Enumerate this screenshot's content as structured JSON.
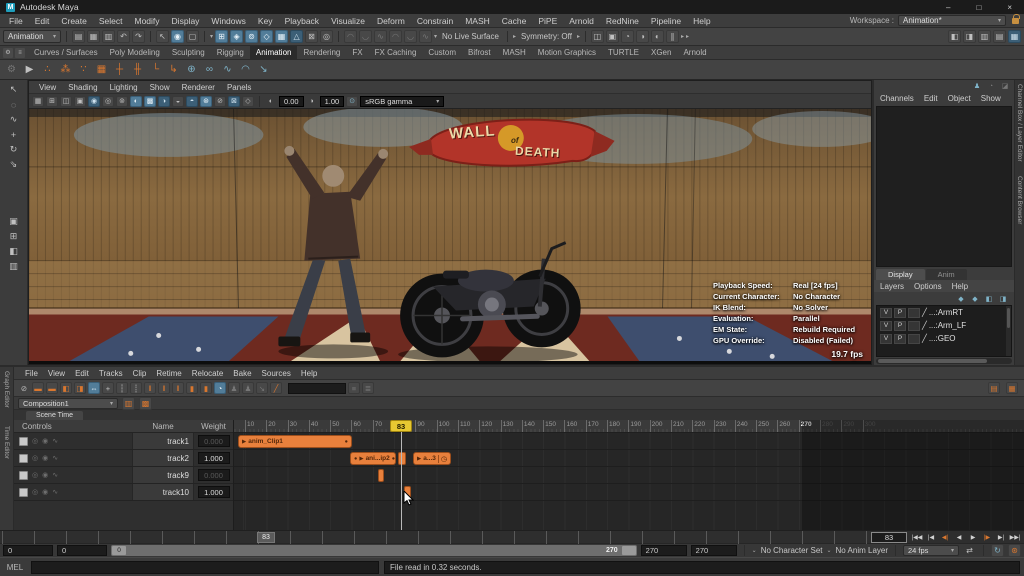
{
  "titlebar": {
    "app_title": "Autodesk Maya",
    "logo": "M"
  },
  "window_controls": {
    "minimize": "–",
    "maximize": "□",
    "close": "×"
  },
  "menubar": {
    "items": [
      "File",
      "Edit",
      "Create",
      "Select",
      "Modify",
      "Display",
      "Windows",
      "Key",
      "Playback",
      "Visualize",
      "Deform",
      "Constrain",
      "MASH",
      "Cache",
      "PiPE",
      "Arnold",
      "RedNine",
      "Pipeline",
      "Help"
    ]
  },
  "workspace": {
    "label": "Workspace :",
    "value": "Animation*"
  },
  "main_toolbar": {
    "mode": "Animation",
    "no_live_surface": "No Live Surface",
    "symmetry": "Symmetry: Off",
    "left_icons": [
      {
        "name": "file-new-icon",
        "g": "▤"
      },
      {
        "name": "file-open-icon",
        "g": "▦"
      },
      {
        "name": "file-save-icon",
        "g": "▥"
      },
      {
        "name": "undo-icon",
        "g": "↶"
      },
      {
        "name": "redo-icon",
        "g": "↷"
      }
    ],
    "select_icons": [
      {
        "name": "select-object-icon",
        "g": "↖"
      },
      {
        "name": "select-hierarchy-icon",
        "g": "◉",
        "c": "hl"
      },
      {
        "name": "select-component-icon",
        "g": "▢"
      }
    ],
    "snap_icons": [
      {
        "name": "snap-grid-icon",
        "g": "⊞",
        "c": "hl"
      },
      {
        "name": "snap-curve-icon",
        "g": "◈",
        "c": "hl"
      },
      {
        "name": "snap-point-icon",
        "g": "⊚",
        "c": "hl"
      },
      {
        "name": "snap-plane-icon",
        "g": "◇",
        "c": "hl"
      },
      {
        "name": "snap-view-icon",
        "g": "▦",
        "c": "hl"
      },
      {
        "name": "make-live-icon",
        "g": "△",
        "c": "hl2"
      },
      {
        "name": "lock-selection-icon",
        "g": "⊠"
      },
      {
        "name": "highlight-selection-icon",
        "g": "◎"
      }
    ],
    "history_icons": [
      {
        "name": "construction-history-icon",
        "g": "◠",
        "c": "dim"
      },
      {
        "name": "curve-smooth-icon",
        "g": "◡",
        "c": "dim"
      },
      {
        "name": "curve-edit-icon",
        "g": "∿",
        "c": "dim"
      },
      {
        "name": "curve-rebuild-icon",
        "g": "◠",
        "c": "dim"
      },
      {
        "name": "curve-project-icon",
        "g": "◡",
        "c": "dim"
      },
      {
        "name": "curve-attach-icon",
        "g": "∿",
        "c": "dim"
      }
    ],
    "render_icons": [
      {
        "name": "render-frame-icon",
        "g": "◫"
      },
      {
        "name": "render-region-icon",
        "g": "▣"
      },
      {
        "name": "ipr-render-icon",
        "g": "◔"
      },
      {
        "name": "render-settings-icon",
        "g": "◑"
      },
      {
        "name": "light-editor-icon",
        "g": "◐"
      },
      {
        "name": "pause-viewport-icon",
        "g": "∥"
      }
    ],
    "panel_toggle_icons": [
      {
        "name": "toggle-attribute-editor-icon",
        "g": "◧"
      },
      {
        "name": "toggle-toolbox-icon",
        "g": "◨"
      },
      {
        "name": "toggle-channel-box-icon",
        "g": "▥"
      },
      {
        "name": "toggle-layer-editor-icon",
        "g": "▤"
      },
      {
        "name": "toggle-outliner-icon",
        "g": "▦",
        "c": "hl2"
      }
    ]
  },
  "shelf": {
    "tabs": [
      "Curves / Surfaces",
      "Poly Modeling",
      "Sculpting",
      "Rigging",
      "Animation",
      "Rendering",
      "FX",
      "FX Caching",
      "Custom",
      "Bifrost",
      "MASH",
      "Motion Graphics",
      "TURTLE",
      "XGen",
      "Arnold"
    ],
    "icons": [
      {
        "name": "shelf-gear-icon",
        "g": "⚙",
        "c": "dim"
      },
      {
        "name": "playblast-icon",
        "g": "▶"
      },
      {
        "name": "set-key-icon",
        "g": "∴",
        "c": "or"
      },
      {
        "name": "set-breakdown-icon",
        "g": "⁂",
        "c": "or"
      },
      {
        "name": "set-driven-key-icon",
        "g": "∵",
        "c": "or"
      },
      {
        "name": "hold-current-keys-icon",
        "g": "▦",
        "c": "or"
      },
      {
        "name": "insert-key-icon",
        "g": "┼",
        "c": "or"
      },
      {
        "name": "insert-blend-icon",
        "g": "╫",
        "c": "or"
      },
      {
        "name": "move-key-icon",
        "g": "└",
        "c": "or"
      },
      {
        "name": "offset-key-icon",
        "g": "↳",
        "c": "or"
      },
      {
        "name": "ik-handle-icon",
        "g": "⊕",
        "c": "teal"
      },
      {
        "name": "constraint-link-icon",
        "g": "∞",
        "c": "teal"
      },
      {
        "name": "anim-curve-icon",
        "g": "∿",
        "c": "teal"
      },
      {
        "name": "arc-tool-icon",
        "g": "◠",
        "c": "teal"
      },
      {
        "name": "motion-trail-icon",
        "g": "↘",
        "c": "teal"
      }
    ]
  },
  "toolbox": {
    "tools": [
      {
        "name": "select-tool-icon",
        "g": "↖"
      },
      {
        "name": "lasso-tool-icon",
        "g": "◌"
      },
      {
        "name": "paint-select-tool-icon",
        "g": "∿"
      },
      {
        "name": "move-tool-icon",
        "g": "+"
      },
      {
        "name": "rotate-tool-icon",
        "g": "↻"
      },
      {
        "name": "scale-tool-icon",
        "g": "⇘"
      }
    ],
    "layouts": [
      {
        "name": "layout-single-icon",
        "g": "▣"
      },
      {
        "name": "layout-four-view-icon",
        "g": "⊞"
      },
      {
        "name": "layout-split-icon",
        "g": "◧"
      },
      {
        "name": "layout-outliner-icon",
        "g": "▥"
      }
    ]
  },
  "viewport": {
    "menu": [
      "View",
      "Shading",
      "Lighting",
      "Show",
      "Renderer",
      "Panels"
    ],
    "toolbar_icons": [
      {
        "name": "vp-select-camera-icon",
        "g": "▦"
      },
      {
        "name": "vp-grid-icon",
        "g": "⊞"
      },
      {
        "name": "vp-film-gate-icon",
        "g": "◫"
      },
      {
        "name": "vp-resolution-gate-icon",
        "g": "▣"
      },
      {
        "name": "vp-gate-mask-icon",
        "g": "◉",
        "c": "hl2"
      },
      {
        "name": "vp-field-chart-icon",
        "g": "◎"
      },
      {
        "name": "vp-safe-action-icon",
        "g": "⊚"
      },
      {
        "name": "vp-wireframe-icon",
        "g": "◐",
        "c": "hl"
      },
      {
        "name": "vp-shaded-icon",
        "g": "▩",
        "c": "hl"
      },
      {
        "name": "vp-textured-icon",
        "g": "◑",
        "c": "hl2"
      },
      {
        "name": "vp-lights-icon",
        "g": "◒"
      },
      {
        "name": "vp-shadows-icon",
        "g": "◓",
        "c": "hl2"
      },
      {
        "name": "vp-ao-icon",
        "g": "⊛",
        "c": "hl"
      },
      {
        "name": "vp-motion-blur-icon",
        "g": "⊘"
      },
      {
        "name": "vp-xray-icon",
        "g": "⊠",
        "c": "hl2"
      },
      {
        "name": "vp-isolate-icon",
        "g": "◇"
      }
    ],
    "exposure_icon": "◐",
    "exposure": "0.00",
    "gamma_icon": "◑",
    "gamma": "1.00",
    "color_mgmt_icon": "⊙",
    "color_space": "sRGB gamma",
    "banner": {
      "word1": "WALL",
      "word2": "of",
      "word3": "DEATH"
    },
    "hud": {
      "rows": [
        {
          "label": "Playback Speed:",
          "value": "Real [24 fps]"
        },
        {
          "label": "Current Character:",
          "value": "No Character"
        },
        {
          "label": "IK Blend:",
          "value": "No Solver"
        },
        {
          "label": "Evaluation:",
          "value": "Parallel"
        },
        {
          "label": "EM State:",
          "value": "Rebuild Required"
        },
        {
          "label": "GPU Override:",
          "value": "Disabled (Failed)"
        }
      ],
      "fps": "19.7 fps"
    }
  },
  "channel_box": {
    "top_icons": [
      {
        "name": "show-manipulators-icon",
        "g": "♟",
        "c": "teal"
      },
      {
        "name": "speed-state-icon",
        "g": "◔",
        "c": "dim"
      },
      {
        "name": "edit-channels-icon",
        "g": "◪",
        "c": "dim"
      }
    ],
    "menu": [
      "Channels",
      "Edit",
      "Object",
      "Show"
    ],
    "side_tab_top": "Channel Box / Layer Editor",
    "side_tab_bottom": "Content Browser",
    "layer_tabs": [
      "Display",
      "Anim"
    ],
    "layer_menu": [
      "Layers",
      "Options",
      "Help"
    ],
    "layer_icons": [
      {
        "name": "move-layer-up-icon",
        "g": "◆",
        "c": "teal"
      },
      {
        "name": "move-layer-down-icon",
        "g": "◆",
        "c": "teal"
      },
      {
        "name": "empty-layer-icon",
        "g": "◧",
        "c": "teal"
      },
      {
        "name": "new-layer-icon",
        "g": "◨",
        "c": "teal"
      }
    ],
    "layers": [
      {
        "v": "V",
        "p": "P",
        "name": "...:ArmRT"
      },
      {
        "v": "V",
        "p": "P",
        "name": "...:Arm_LF"
      },
      {
        "v": "V",
        "p": "P",
        "name": "...:GEO"
      }
    ]
  },
  "time_editor": {
    "side_tabs": {
      "top": "Graph Editor",
      "bottom": "Time Editor"
    },
    "menu": [
      "File",
      "View",
      "Edit",
      "Tracks",
      "Clip",
      "Retime",
      "Relocate",
      "Bake",
      "Sources",
      "Help"
    ],
    "toolbar_icons": [
      {
        "name": "te-no-clip-icon",
        "g": "⊘",
        "c": "plain"
      },
      {
        "name": "te-add-clip-icon",
        "g": "▬",
        "c": "or"
      },
      {
        "name": "te-add-pose-clip-icon",
        "g": "▬",
        "c": "or"
      },
      {
        "name": "te-add-audio-icon",
        "g": "◧",
        "c": "or"
      },
      {
        "name": "te-add-group-icon",
        "g": "◨",
        "c": "or"
      },
      {
        "name": "te-move-tool-icon",
        "g": "⇔",
        "c": "hl"
      },
      {
        "name": "te-ripple-tool-icon",
        "g": "+"
      },
      {
        "name": "te-trim-left-icon",
        "g": "┆"
      },
      {
        "name": "te-trim-right-icon",
        "g": "┊"
      },
      {
        "name": "te-split-icon",
        "g": "‖",
        "c": "or"
      },
      {
        "name": "te-merge-icon",
        "g": "‖",
        "c": "or"
      },
      {
        "name": "te-group-clips-icon",
        "g": "‖",
        "c": "or"
      },
      {
        "name": "te-crossfade-icon",
        "g": "▮",
        "c": "or"
      },
      {
        "name": "te-hold-icon",
        "g": "▮",
        "c": "or"
      },
      {
        "name": "te-loop-clip-icon",
        "g": "◔",
        "c": "hl"
      },
      {
        "name": "te-char-a-icon",
        "g": "♟",
        "c": "dim"
      },
      {
        "name": "te-char-b-icon",
        "g": "♟",
        "c": "dim"
      },
      {
        "name": "te-export-icon",
        "g": "↘",
        "c": "dim"
      },
      {
        "name": "te-keying-icon",
        "g": "╱",
        "c": "or"
      }
    ],
    "toolbar_end_icons": [
      {
        "name": "te-list-icon",
        "g": "≡",
        "c": "dim"
      },
      {
        "name": "te-options-icon",
        "g": "≣",
        "c": "dim"
      }
    ],
    "bookmark_icons": [
      {
        "name": "te-bookmark-icon",
        "g": "▤",
        "c": "or"
      },
      {
        "name": "te-grid-bookmark-icon",
        "g": "▦",
        "c": "or"
      }
    ],
    "composition": "Composition1",
    "comp_icons": [
      {
        "name": "new-composition-icon",
        "g": "▥",
        "c": "or"
      },
      {
        "name": "manage-compositions-icon",
        "g": "▩",
        "c": "or"
      }
    ],
    "scene_tab": "Scene Time",
    "columns": [
      "Controls",
      "Name",
      "Weight"
    ],
    "track_icons": [
      {
        "name": "track-mute-icon",
        "g": "◎"
      },
      {
        "name": "track-solo-icon",
        "g": "◉"
      },
      {
        "name": "track-ghost-icon",
        "g": "∿"
      }
    ],
    "tracks": [
      {
        "name": "track1",
        "weight": "0.000",
        "enabled": "false"
      },
      {
        "name": "track2",
        "weight": "1.000",
        "enabled": "true"
      },
      {
        "name": "track9",
        "weight": "0.000",
        "enabled": "false"
      },
      {
        "name": "track10",
        "weight": "1.000",
        "enabled": "true"
      }
    ],
    "clips": {
      "clip1": "anim_Clip1",
      "clip2": "ani...ip2",
      "clip3": "a...3"
    },
    "ruler": [
      "10",
      "20",
      "30",
      "40",
      "50",
      "60",
      "70",
      "80",
      "90",
      "100",
      "110",
      "120",
      "130",
      "140",
      "150",
      "160",
      "170",
      "180",
      "190",
      "200",
      "210",
      "220",
      "230",
      "240",
      "250",
      "260",
      "270",
      "280",
      "290",
      "300"
    ],
    "playhead": "83"
  },
  "playback": {
    "slider_frame": "83",
    "current_frame": "83",
    "range_start": "0",
    "anim_start": "0",
    "bar_start": "0",
    "bar_end": "270",
    "range_end": "270",
    "anim_end": "270",
    "character_set": "No Character Set",
    "anim_layer": "No Anim Layer",
    "fps": "24 fps",
    "transport": [
      "|◀◀",
      "|◀",
      "◀|",
      "◀",
      "▶",
      "|▶",
      "▶|",
      "▶▶|"
    ]
  },
  "command_line": {
    "label": "MEL",
    "help": "File read in 0.32 seconds."
  },
  "icons": {
    "caret_down": "▾",
    "caret_down_small": "⌄",
    "caret_right": "▸",
    "play": "▶",
    "dot": "●",
    "clock": "◷",
    "loop": "⇄",
    "update": "↻",
    "char_star": "⊛",
    "gear": "⚙",
    "list": "≡"
  }
}
